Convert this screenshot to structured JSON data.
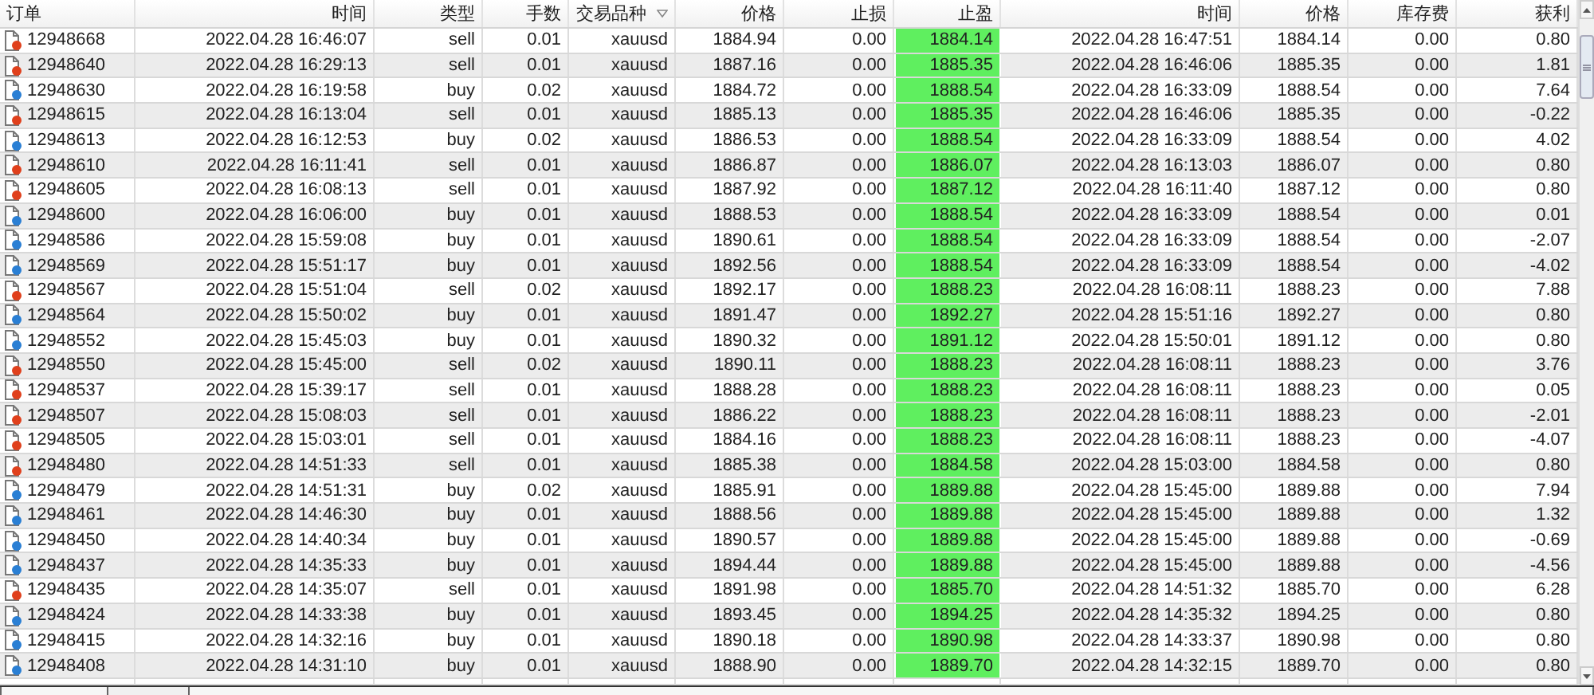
{
  "columns": [
    {
      "label": "订单",
      "sorted": false
    },
    {
      "label": "时间",
      "sorted": false
    },
    {
      "label": "类型",
      "sorted": false
    },
    {
      "label": "手数",
      "sorted": false
    },
    {
      "label": "交易品种",
      "sorted": true
    },
    {
      "label": "价格",
      "sorted": false
    },
    {
      "label": "止损",
      "sorted": false
    },
    {
      "label": "止盈",
      "sorted": false
    },
    {
      "label": "时间",
      "sorted": false
    },
    {
      "label": "价格",
      "sorted": false
    },
    {
      "label": "库存费",
      "sorted": false
    },
    {
      "label": "获利",
      "sorted": false
    }
  ],
  "rows": [
    {
      "kind": "sell",
      "order": "12948668",
      "open_time": "2022.04.28 16:46:07",
      "type": "sell",
      "lots": "0.01",
      "symbol": "xauusd",
      "price": "1884.94",
      "sl": "0.00",
      "tp": "1884.14",
      "close_time": "2022.04.28 16:47:51",
      "close_price": "1884.14",
      "swap": "0.00",
      "profit": "0.80"
    },
    {
      "kind": "sell",
      "order": "12948640",
      "open_time": "2022.04.28 16:29:13",
      "type": "sell",
      "lots": "0.01",
      "symbol": "xauusd",
      "price": "1887.16",
      "sl": "0.00",
      "tp": "1885.35",
      "close_time": "2022.04.28 16:46:06",
      "close_price": "1885.35",
      "swap": "0.00",
      "profit": "1.81"
    },
    {
      "kind": "buy",
      "order": "12948630",
      "open_time": "2022.04.28 16:19:58",
      "type": "buy",
      "lots": "0.02",
      "symbol": "xauusd",
      "price": "1884.72",
      "sl": "0.00",
      "tp": "1888.54",
      "close_time": "2022.04.28 16:33:09",
      "close_price": "1888.54",
      "swap": "0.00",
      "profit": "7.64"
    },
    {
      "kind": "sell",
      "order": "12948615",
      "open_time": "2022.04.28 16:13:04",
      "type": "sell",
      "lots": "0.01",
      "symbol": "xauusd",
      "price": "1885.13",
      "sl": "0.00",
      "tp": "1885.35",
      "close_time": "2022.04.28 16:46:06",
      "close_price": "1885.35",
      "swap": "0.00",
      "profit": "-0.22"
    },
    {
      "kind": "buy",
      "order": "12948613",
      "open_time": "2022.04.28 16:12:53",
      "type": "buy",
      "lots": "0.02",
      "symbol": "xauusd",
      "price": "1886.53",
      "sl": "0.00",
      "tp": "1888.54",
      "close_time": "2022.04.28 16:33:09",
      "close_price": "1888.54",
      "swap": "0.00",
      "profit": "4.02"
    },
    {
      "kind": "sell",
      "order": "12948610",
      "open_time": "2022.04.28 16:11:41",
      "type": "sell",
      "lots": "0.01",
      "symbol": "xauusd",
      "price": "1886.87",
      "sl": "0.00",
      "tp": "1886.07",
      "close_time": "2022.04.28 16:13:03",
      "close_price": "1886.07",
      "swap": "0.00",
      "profit": "0.80"
    },
    {
      "kind": "sell",
      "order": "12948605",
      "open_time": "2022.04.28 16:08:13",
      "type": "sell",
      "lots": "0.01",
      "symbol": "xauusd",
      "price": "1887.92",
      "sl": "0.00",
      "tp": "1887.12",
      "close_time": "2022.04.28 16:11:40",
      "close_price": "1887.12",
      "swap": "0.00",
      "profit": "0.80"
    },
    {
      "kind": "buy",
      "order": "12948600",
      "open_time": "2022.04.28 16:06:00",
      "type": "buy",
      "lots": "0.01",
      "symbol": "xauusd",
      "price": "1888.53",
      "sl": "0.00",
      "tp": "1888.54",
      "close_time": "2022.04.28 16:33:09",
      "close_price": "1888.54",
      "swap": "0.00",
      "profit": "0.01"
    },
    {
      "kind": "buy",
      "order": "12948586",
      "open_time": "2022.04.28 15:59:08",
      "type": "buy",
      "lots": "0.01",
      "symbol": "xauusd",
      "price": "1890.61",
      "sl": "0.00",
      "tp": "1888.54",
      "close_time": "2022.04.28 16:33:09",
      "close_price": "1888.54",
      "swap": "0.00",
      "profit": "-2.07"
    },
    {
      "kind": "buy",
      "order": "12948569",
      "open_time": "2022.04.28 15:51:17",
      "type": "buy",
      "lots": "0.01",
      "symbol": "xauusd",
      "price": "1892.56",
      "sl": "0.00",
      "tp": "1888.54",
      "close_time": "2022.04.28 16:33:09",
      "close_price": "1888.54",
      "swap": "0.00",
      "profit": "-4.02"
    },
    {
      "kind": "sell",
      "order": "12948567",
      "open_time": "2022.04.28 15:51:04",
      "type": "sell",
      "lots": "0.02",
      "symbol": "xauusd",
      "price": "1892.17",
      "sl": "0.00",
      "tp": "1888.23",
      "close_time": "2022.04.28 16:08:11",
      "close_price": "1888.23",
      "swap": "0.00",
      "profit": "7.88"
    },
    {
      "kind": "buy",
      "order": "12948564",
      "open_time": "2022.04.28 15:50:02",
      "type": "buy",
      "lots": "0.01",
      "symbol": "xauusd",
      "price": "1891.47",
      "sl": "0.00",
      "tp": "1892.27",
      "close_time": "2022.04.28 15:51:16",
      "close_price": "1892.27",
      "swap": "0.00",
      "profit": "0.80"
    },
    {
      "kind": "buy",
      "order": "12948552",
      "open_time": "2022.04.28 15:45:03",
      "type": "buy",
      "lots": "0.01",
      "symbol": "xauusd",
      "price": "1890.32",
      "sl": "0.00",
      "tp": "1891.12",
      "close_time": "2022.04.28 15:50:01",
      "close_price": "1891.12",
      "swap": "0.00",
      "profit": "0.80"
    },
    {
      "kind": "sell",
      "order": "12948550",
      "open_time": "2022.04.28 15:45:00",
      "type": "sell",
      "lots": "0.02",
      "symbol": "xauusd",
      "price": "1890.11",
      "sl": "0.00",
      "tp": "1888.23",
      "close_time": "2022.04.28 16:08:11",
      "close_price": "1888.23",
      "swap": "0.00",
      "profit": "3.76"
    },
    {
      "kind": "sell",
      "order": "12948537",
      "open_time": "2022.04.28 15:39:17",
      "type": "sell",
      "lots": "0.01",
      "symbol": "xauusd",
      "price": "1888.28",
      "sl": "0.00",
      "tp": "1888.23",
      "close_time": "2022.04.28 16:08:11",
      "close_price": "1888.23",
      "swap": "0.00",
      "profit": "0.05"
    },
    {
      "kind": "sell",
      "order": "12948507",
      "open_time": "2022.04.28 15:08:03",
      "type": "sell",
      "lots": "0.01",
      "symbol": "xauusd",
      "price": "1886.22",
      "sl": "0.00",
      "tp": "1888.23",
      "close_time": "2022.04.28 16:08:11",
      "close_price": "1888.23",
      "swap": "0.00",
      "profit": "-2.01"
    },
    {
      "kind": "sell",
      "order": "12948505",
      "open_time": "2022.04.28 15:03:01",
      "type": "sell",
      "lots": "0.01",
      "symbol": "xauusd",
      "price": "1884.16",
      "sl": "0.00",
      "tp": "1888.23",
      "close_time": "2022.04.28 16:08:11",
      "close_price": "1888.23",
      "swap": "0.00",
      "profit": "-4.07"
    },
    {
      "kind": "sell",
      "order": "12948480",
      "open_time": "2022.04.28 14:51:33",
      "type": "sell",
      "lots": "0.01",
      "symbol": "xauusd",
      "price": "1885.38",
      "sl": "0.00",
      "tp": "1884.58",
      "close_time": "2022.04.28 15:03:00",
      "close_price": "1884.58",
      "swap": "0.00",
      "profit": "0.80"
    },
    {
      "kind": "buy",
      "order": "12948479",
      "open_time": "2022.04.28 14:51:31",
      "type": "buy",
      "lots": "0.02",
      "symbol": "xauusd",
      "price": "1885.91",
      "sl": "0.00",
      "tp": "1889.88",
      "close_time": "2022.04.28 15:45:00",
      "close_price": "1889.88",
      "swap": "0.00",
      "profit": "7.94"
    },
    {
      "kind": "buy",
      "order": "12948461",
      "open_time": "2022.04.28 14:46:30",
      "type": "buy",
      "lots": "0.01",
      "symbol": "xauusd",
      "price": "1888.56",
      "sl": "0.00",
      "tp": "1889.88",
      "close_time": "2022.04.28 15:45:00",
      "close_price": "1889.88",
      "swap": "0.00",
      "profit": "1.32"
    },
    {
      "kind": "buy",
      "order": "12948450",
      "open_time": "2022.04.28 14:40:34",
      "type": "buy",
      "lots": "0.01",
      "symbol": "xauusd",
      "price": "1890.57",
      "sl": "0.00",
      "tp": "1889.88",
      "close_time": "2022.04.28 15:45:00",
      "close_price": "1889.88",
      "swap": "0.00",
      "profit": "-0.69"
    },
    {
      "kind": "buy",
      "order": "12948437",
      "open_time": "2022.04.28 14:35:33",
      "type": "buy",
      "lots": "0.01",
      "symbol": "xauusd",
      "price": "1894.44",
      "sl": "0.00",
      "tp": "1889.88",
      "close_time": "2022.04.28 15:45:00",
      "close_price": "1889.88",
      "swap": "0.00",
      "profit": "-4.56"
    },
    {
      "kind": "sell",
      "order": "12948435",
      "open_time": "2022.04.28 14:35:07",
      "type": "sell",
      "lots": "0.01",
      "symbol": "xauusd",
      "price": "1891.98",
      "sl": "0.00",
      "tp": "1885.70",
      "close_time": "2022.04.28 14:51:32",
      "close_price": "1885.70",
      "swap": "0.00",
      "profit": "6.28"
    },
    {
      "kind": "buy",
      "order": "12948424",
      "open_time": "2022.04.28 14:33:38",
      "type": "buy",
      "lots": "0.01",
      "symbol": "xauusd",
      "price": "1893.45",
      "sl": "0.00",
      "tp": "1894.25",
      "close_time": "2022.04.28 14:35:32",
      "close_price": "1894.25",
      "swap": "0.00",
      "profit": "0.80"
    },
    {
      "kind": "buy",
      "order": "12948415",
      "open_time": "2022.04.28 14:32:16",
      "type": "buy",
      "lots": "0.01",
      "symbol": "xauusd",
      "price": "1890.18",
      "sl": "0.00",
      "tp": "1890.98",
      "close_time": "2022.04.28 14:33:37",
      "close_price": "1890.98",
      "swap": "0.00",
      "profit": "0.80"
    },
    {
      "kind": "buy",
      "order": "12948408",
      "open_time": "2022.04.28 14:31:10",
      "type": "buy",
      "lots": "0.01",
      "symbol": "xauusd",
      "price": "1888.90",
      "sl": "0.00",
      "tp": "1889.70",
      "close_time": "2022.04.28 14:32:15",
      "close_price": "1889.70",
      "swap": "0.00",
      "profit": "0.80"
    }
  ]
}
